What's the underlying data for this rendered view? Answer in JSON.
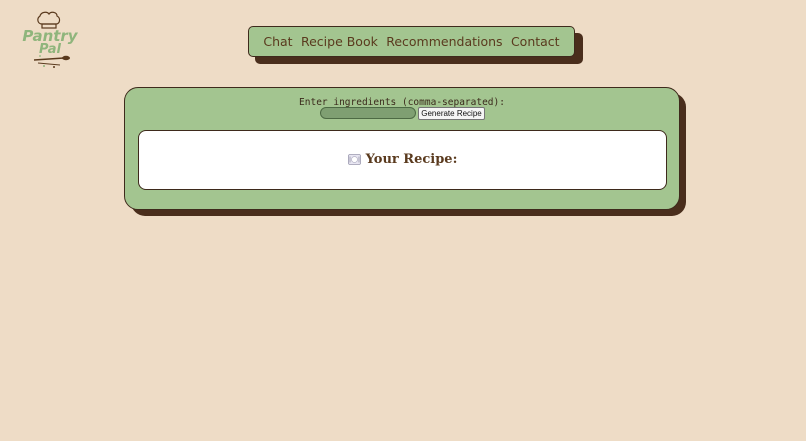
{
  "logo": {
    "line1": "Pantry",
    "line2": "Pal",
    "icon": "chef-hat-icon"
  },
  "nav": {
    "items": [
      {
        "label": "Chat"
      },
      {
        "label": "Recipe Book"
      },
      {
        "label": "Recommendations"
      },
      {
        "label": "Contact"
      }
    ]
  },
  "generator": {
    "prompt_label": "Enter ingredients (comma-separated):",
    "input_value": "",
    "input_placeholder": "",
    "button_label": "Generate Recipe"
  },
  "recipe": {
    "icon": "plate-icon",
    "title": "Your Recipe:"
  },
  "colors": {
    "background": "#eedcc6",
    "panel_green": "#a3c590",
    "shadow_brown": "#4a2e1c",
    "text_brown": "#5a3a1e",
    "logo_green": "#8fb57c"
  }
}
